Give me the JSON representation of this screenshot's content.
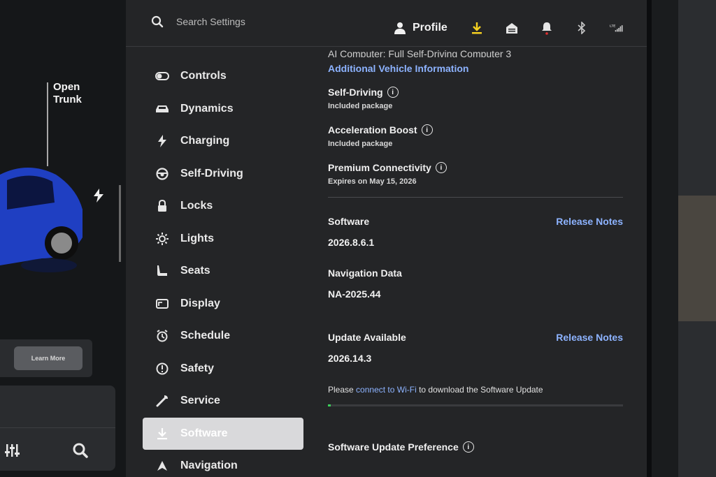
{
  "left_panel": {
    "open_trunk_line1": "Open",
    "open_trunk_line2": "Trunk",
    "learn_more": "Learn More"
  },
  "search": {
    "placeholder": "Search Settings"
  },
  "topbar": {
    "profile_label": "Profile"
  },
  "nav": {
    "items": [
      {
        "label": "Controls",
        "icon": "toggle-icon"
      },
      {
        "label": "Dynamics",
        "icon": "car-icon"
      },
      {
        "label": "Charging",
        "icon": "bolt-icon"
      },
      {
        "label": "Self-Driving",
        "icon": "steering-wheel-icon"
      },
      {
        "label": "Locks",
        "icon": "lock-icon"
      },
      {
        "label": "Lights",
        "icon": "sun-icon"
      },
      {
        "label": "Seats",
        "icon": "seat-icon"
      },
      {
        "label": "Display",
        "icon": "display-icon"
      },
      {
        "label": "Schedule",
        "icon": "alarm-icon"
      },
      {
        "label": "Safety",
        "icon": "alert-circle-icon"
      },
      {
        "label": "Service",
        "icon": "wrench-icon"
      },
      {
        "label": "Software",
        "icon": "download-icon"
      },
      {
        "label": "Navigation",
        "icon": "navigation-icon"
      }
    ],
    "active": "Software"
  },
  "content": {
    "cut_heading": "AI Computer: Full Self-Driving Computer 3",
    "additional_info_link": "Additional Vehicle Information",
    "self_driving_title": "Self-Driving",
    "self_driving_sub": "Included package",
    "accel_title": "Acceleration Boost",
    "accel_sub": "Included package",
    "premium_title": "Premium Connectivity",
    "premium_sub": "Expires on May 15, 2026",
    "software_label": "Software",
    "release_notes_1": "Release Notes",
    "software_version": "2026.8.6.1",
    "nav_data_label": "Navigation Data",
    "nav_data_value": "NA-2025.44",
    "update_label": "Update Available",
    "release_notes_2": "Release Notes",
    "update_version": "2026.14.3",
    "msg_prefix": "Please",
    "msg_link": "connect to Wi-Fi",
    "msg_suffix": "to download the Software Update",
    "progress_percent": 1,
    "pref_label": "Software Update Preference"
  },
  "colors": {
    "accent_link": "#8db3ff",
    "download_icon": "#f5d020",
    "progress": "#3ccf5a"
  }
}
